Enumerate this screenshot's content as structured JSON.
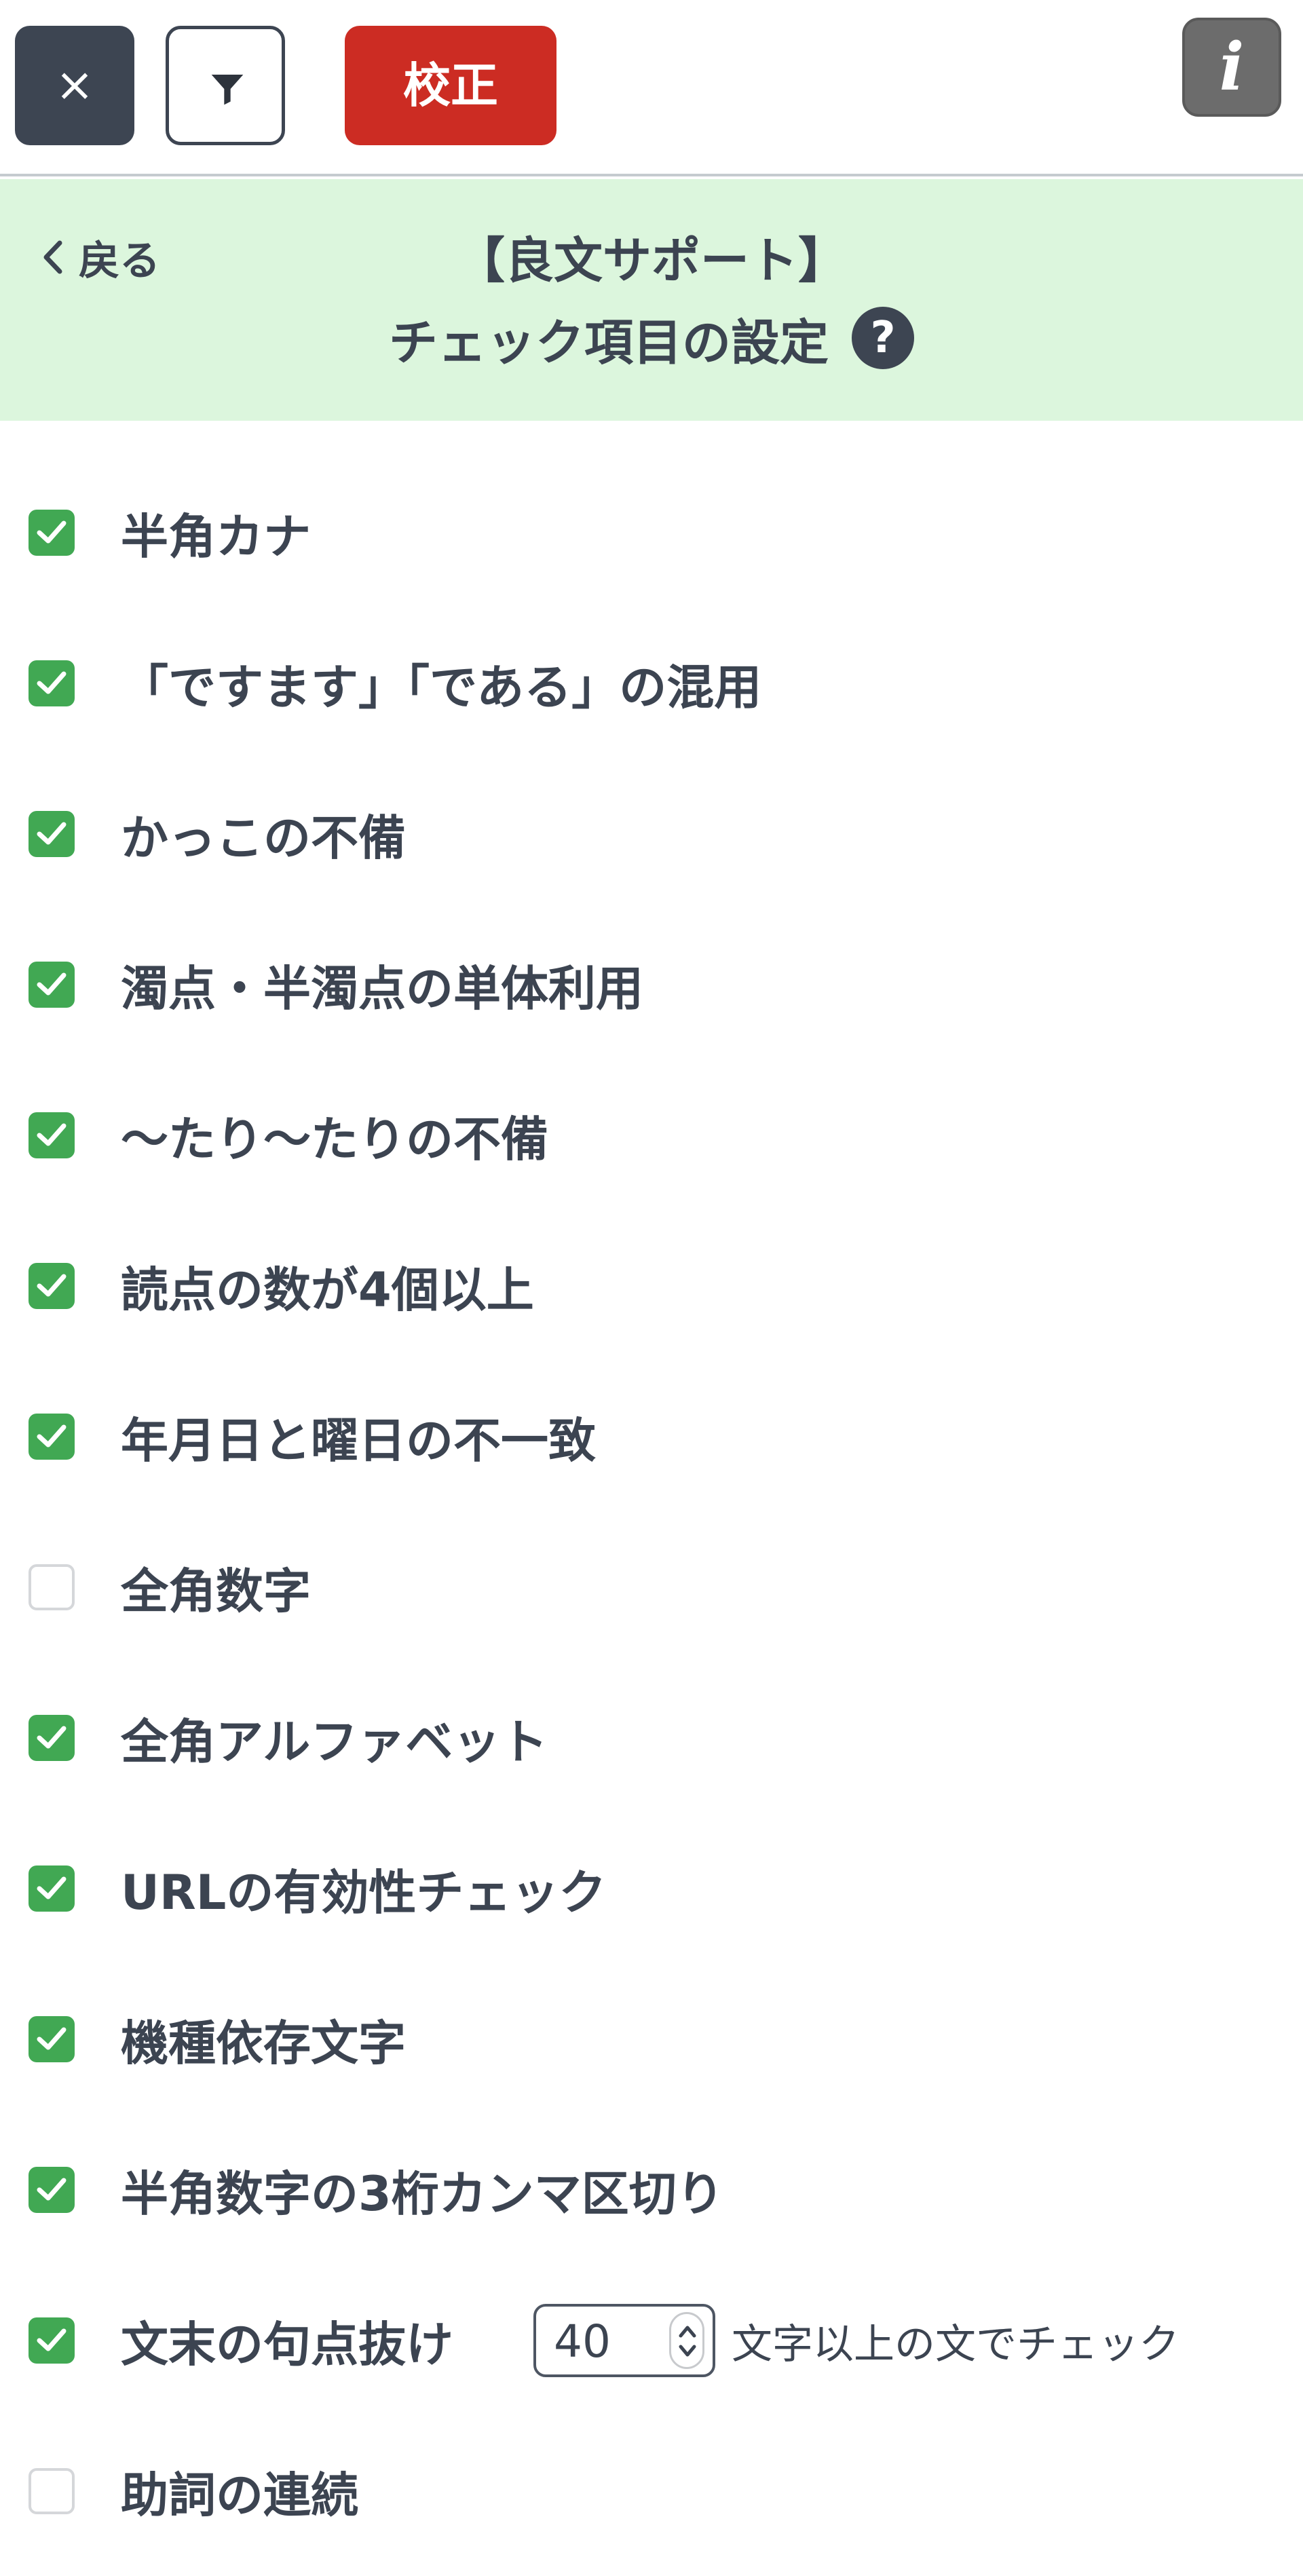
{
  "toolbar": {
    "close_label": "×",
    "filter_icon": "filter-icon",
    "proofread_label": "校正",
    "info_label": "i"
  },
  "header": {
    "back_label": "戻る",
    "title_line1": "【良文サポート】",
    "title_line2": "チェック項目の設定",
    "help_label": "?"
  },
  "colors": {
    "accent_green": "#41a853",
    "proofread_red": "#cc2c23",
    "header_band": "#dcf6dd",
    "dark_button": "#3d4552"
  },
  "items": [
    {
      "label": "半角カナ",
      "checked": true
    },
    {
      "label": "「ですます」「である」の混用",
      "checked": true
    },
    {
      "label": "かっこの不備",
      "checked": true
    },
    {
      "label": "濁点・半濁点の単体利用",
      "checked": true
    },
    {
      "label": "～たり～たりの不備",
      "checked": true
    },
    {
      "label": "読点の数が4個以上",
      "checked": true
    },
    {
      "label": "年月日と曜日の不一致",
      "checked": true
    },
    {
      "label": "全角数字",
      "checked": false
    },
    {
      "label": "全角アルファベット",
      "checked": true
    },
    {
      "label": "URLの有効性チェック",
      "checked": true
    },
    {
      "label": "機種依存文字",
      "checked": true
    },
    {
      "label": "半角数字の3桁カンマ区切り",
      "checked": true
    },
    {
      "label": "文末の句点抜け",
      "checked": true,
      "input_value": "40",
      "suffix": "文字以上の文でチェック"
    },
    {
      "label": "助詞の連続",
      "checked": false
    }
  ]
}
